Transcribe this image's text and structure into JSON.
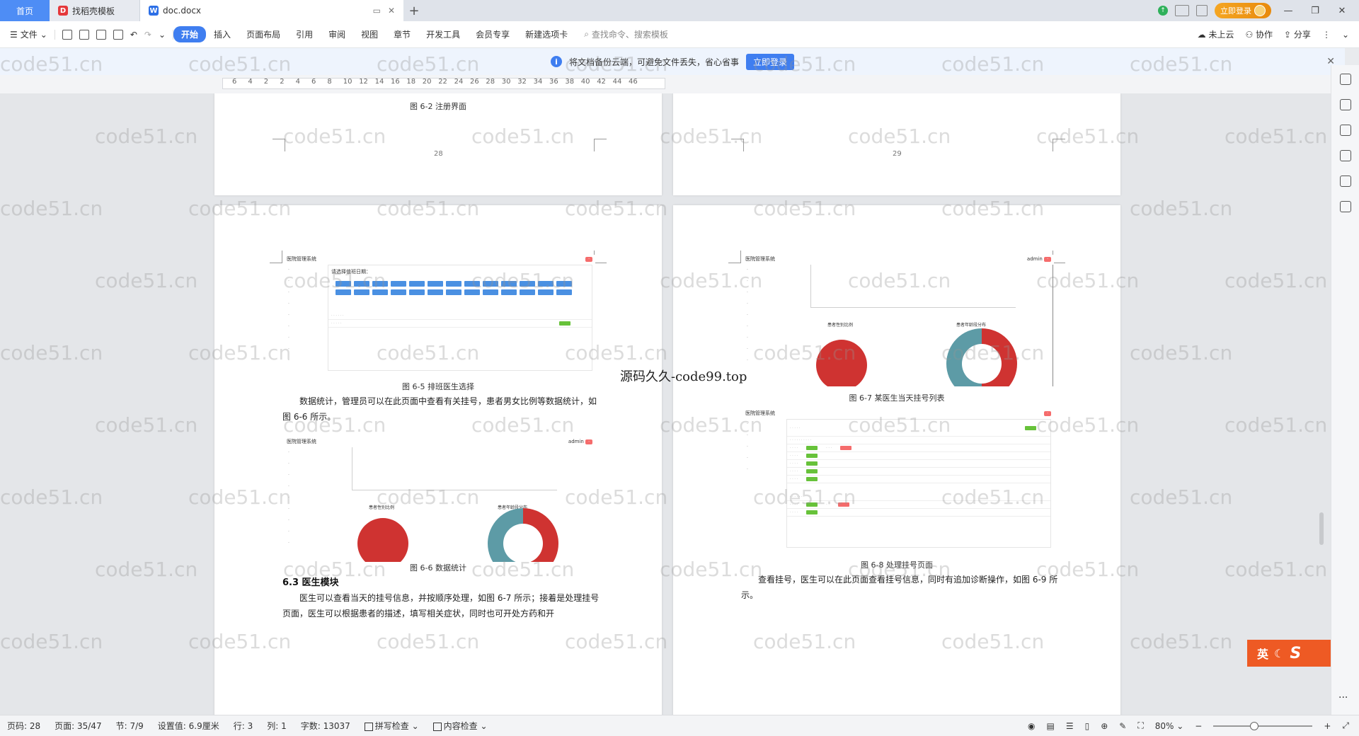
{
  "tabs": {
    "home": "首页",
    "template": "找稻壳模板",
    "doc": "doc.docx"
  },
  "titlebar": {
    "login": "立即登录"
  },
  "ribbon": {
    "file": "文件",
    "menu": [
      "开始",
      "插入",
      "页面布局",
      "引用",
      "审阅",
      "视图",
      "章节",
      "开发工具",
      "会员专享",
      "新建选项卡"
    ],
    "search_placeholder": "查找命令、搜索模板",
    "cloud": "未上云",
    "collab": "协作",
    "share": "分享"
  },
  "notice": {
    "text": "将文档备份云端，可避免文件丢失，省心省事",
    "button": "立即登录"
  },
  "ruler": {
    "ticks": [
      "6",
      "4",
      "2",
      "2",
      "4",
      "6",
      "8",
      "10",
      "12",
      "14",
      "16",
      "18",
      "20",
      "22",
      "24",
      "26",
      "28",
      "30",
      "32",
      "34",
      "36",
      "38",
      "40",
      "42",
      "44",
      "46"
    ]
  },
  "pages": {
    "top_left": {
      "caption": "图 6-2 注册界面",
      "page_no": "28"
    },
    "top_right": {
      "page_no": "29"
    },
    "left": {
      "fig1_caption": "图 6-5 排班医生选择",
      "para1": "数据统计，管理员可以在此页面中查看有关挂号，患者男女比例等数据统计，如图 6-6 所示。",
      "fig2_caption": "图 6-6 数据统计",
      "heading": "6.3 医生模块",
      "para2": "医生可以查看当天的挂号信息，并按顺序处理，如图 6-7 所示；接着是处理挂号页面，医生可以根据患者的描述，填写相关症状，同时也可开处方药和开"
    },
    "right": {
      "fig1_caption": "图 6-7 某医生当天挂号列表",
      "fig2_caption": "图 6-8 处理挂号页面",
      "para1": "查看挂号，医生可以在此页面查看挂号信息，同时有追加诊断操作，如图 6-9 所示。"
    },
    "mini": {
      "app_name": "医院管理系统",
      "schedule_title": "请选择值班日期：",
      "admin": "admin",
      "pie_title": "患者性别比例",
      "donut_title": "患者年龄段分布"
    }
  },
  "watermark": "code51.cn",
  "center_watermark": "源码久久-code99.top",
  "ime": {
    "label": "英"
  },
  "status": {
    "page": "页码: 28",
    "pages": "页面: 35/47",
    "section": "节: 7/9",
    "setting": "设置值: 6.9厘米",
    "row": "行: 3",
    "col": "列: 1",
    "words": "字数: 13037",
    "spell": "拼写检查",
    "content": "内容检查",
    "zoom": "80%"
  }
}
